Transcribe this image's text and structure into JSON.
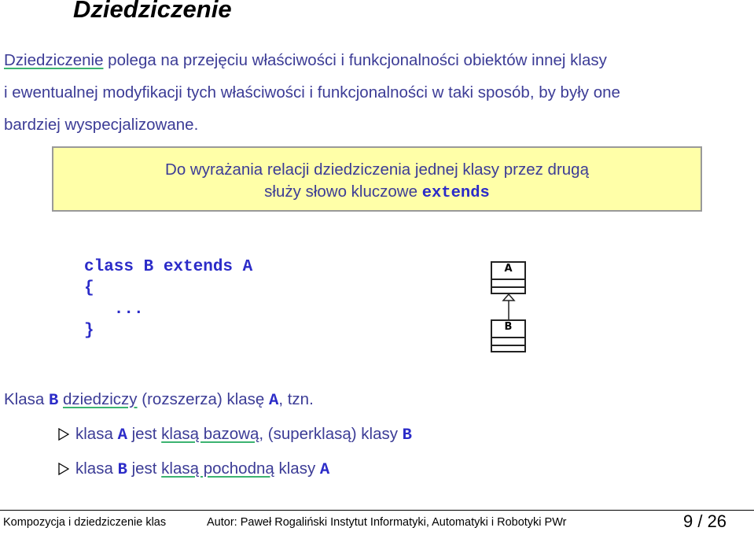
{
  "title": "Dziedziczenie",
  "intro": {
    "link": "Dziedziczenie",
    "line1_rest": " polega na przejęciu właściwości i funkcjonalności obiektów innej klasy",
    "line2": "i ewentualnej modyfikacji tych właściwości i funkcjonalności w taki sposób, by były one",
    "line3": "bardziej wyspecjalizowane."
  },
  "note": {
    "line1": "Do wyrażania relacji dziedziczenia jednej klasy przez drugą",
    "line2_text": "służy słowo kluczowe ",
    "keyword": "extends"
  },
  "code": {
    "line1": "class B extends A",
    "line2": "{",
    "line3": "   ...",
    "line4": "}"
  },
  "uml": {
    "parent": "A",
    "child": "B"
  },
  "summary": {
    "prefix": "Klasa ",
    "class_b": "B",
    "space1": " ",
    "link": "dziedziczy",
    "middle": " (rozszerza) klasę ",
    "class_a": "A",
    "suffix": ", tzn."
  },
  "bullets": [
    {
      "pre": "klasa ",
      "cls": "A",
      "mid": " jest ",
      "link": "klasą bazową",
      "post": ", (superklasą) klasy ",
      "cls2": "B"
    },
    {
      "pre": "klasa ",
      "cls": "B",
      "mid": " jest ",
      "link": "klasą pochodną",
      "post": " klasy ",
      "cls2": "A"
    }
  ],
  "footer": {
    "left": "Kompozycja i dziedziczenie klas",
    "center": "Autor: Paweł Rogaliński  Instytut Informatyki, Automatyki i Robotyki PWr",
    "page": "9 / 26"
  },
  "colors": {
    "text": "#3c3c96",
    "code": "#2b2bc8",
    "note_bg": "#ffffa8",
    "underline": "#3cb371"
  }
}
